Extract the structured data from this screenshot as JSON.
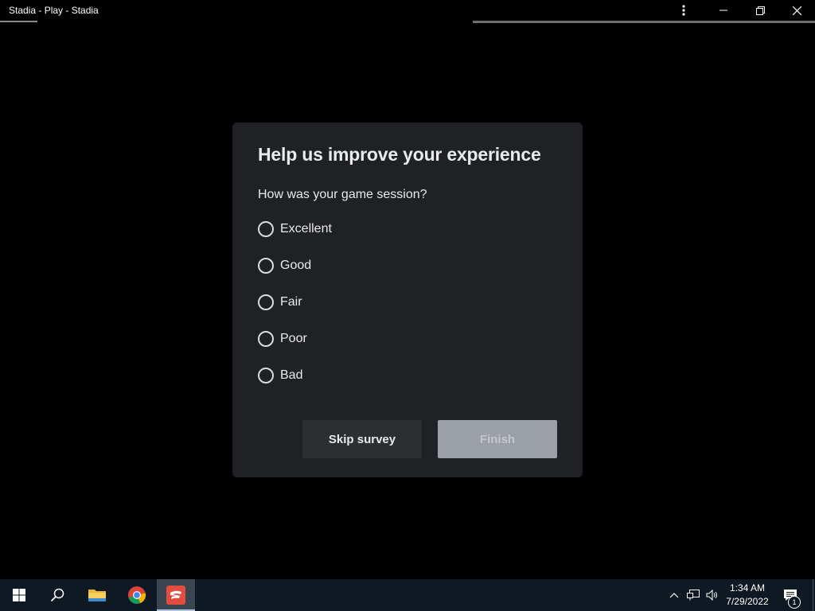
{
  "window": {
    "title": "Stadia - Play - Stadia",
    "menu_icon": "more-vert-icon",
    "minimize_icon": "minimize-icon",
    "restore_icon": "restore-icon",
    "close_icon": "close-icon"
  },
  "dialog": {
    "title": "Help us improve your experience",
    "question": "How was your game session?",
    "options": [
      {
        "label": "Excellent",
        "selected": false
      },
      {
        "label": "Good",
        "selected": false
      },
      {
        "label": "Fair",
        "selected": false
      },
      {
        "label": "Poor",
        "selected": false
      },
      {
        "label": "Bad",
        "selected": false
      }
    ],
    "skip_label": "Skip survey",
    "finish_label": "Finish",
    "finish_enabled": false
  },
  "taskbar": {
    "items": [
      {
        "name": "start",
        "icon": "windows-icon"
      },
      {
        "name": "search",
        "icon": "search-icon"
      },
      {
        "name": "file-explorer",
        "icon": "folder-icon"
      },
      {
        "name": "chrome",
        "icon": "chrome-icon"
      },
      {
        "name": "stadia",
        "icon": "stadia-icon",
        "active": true
      }
    ],
    "tray": {
      "time": "1:34 AM",
      "date": "7/29/2022",
      "notification_count": "1"
    }
  },
  "colors": {
    "background": "#000000",
    "dialog_bg": "#202124",
    "text": "#e8eaed",
    "skip_button_bg": "#2d2e31",
    "finish_button_bg": "#9aa0a6",
    "taskbar_bg": "#0f1923"
  }
}
